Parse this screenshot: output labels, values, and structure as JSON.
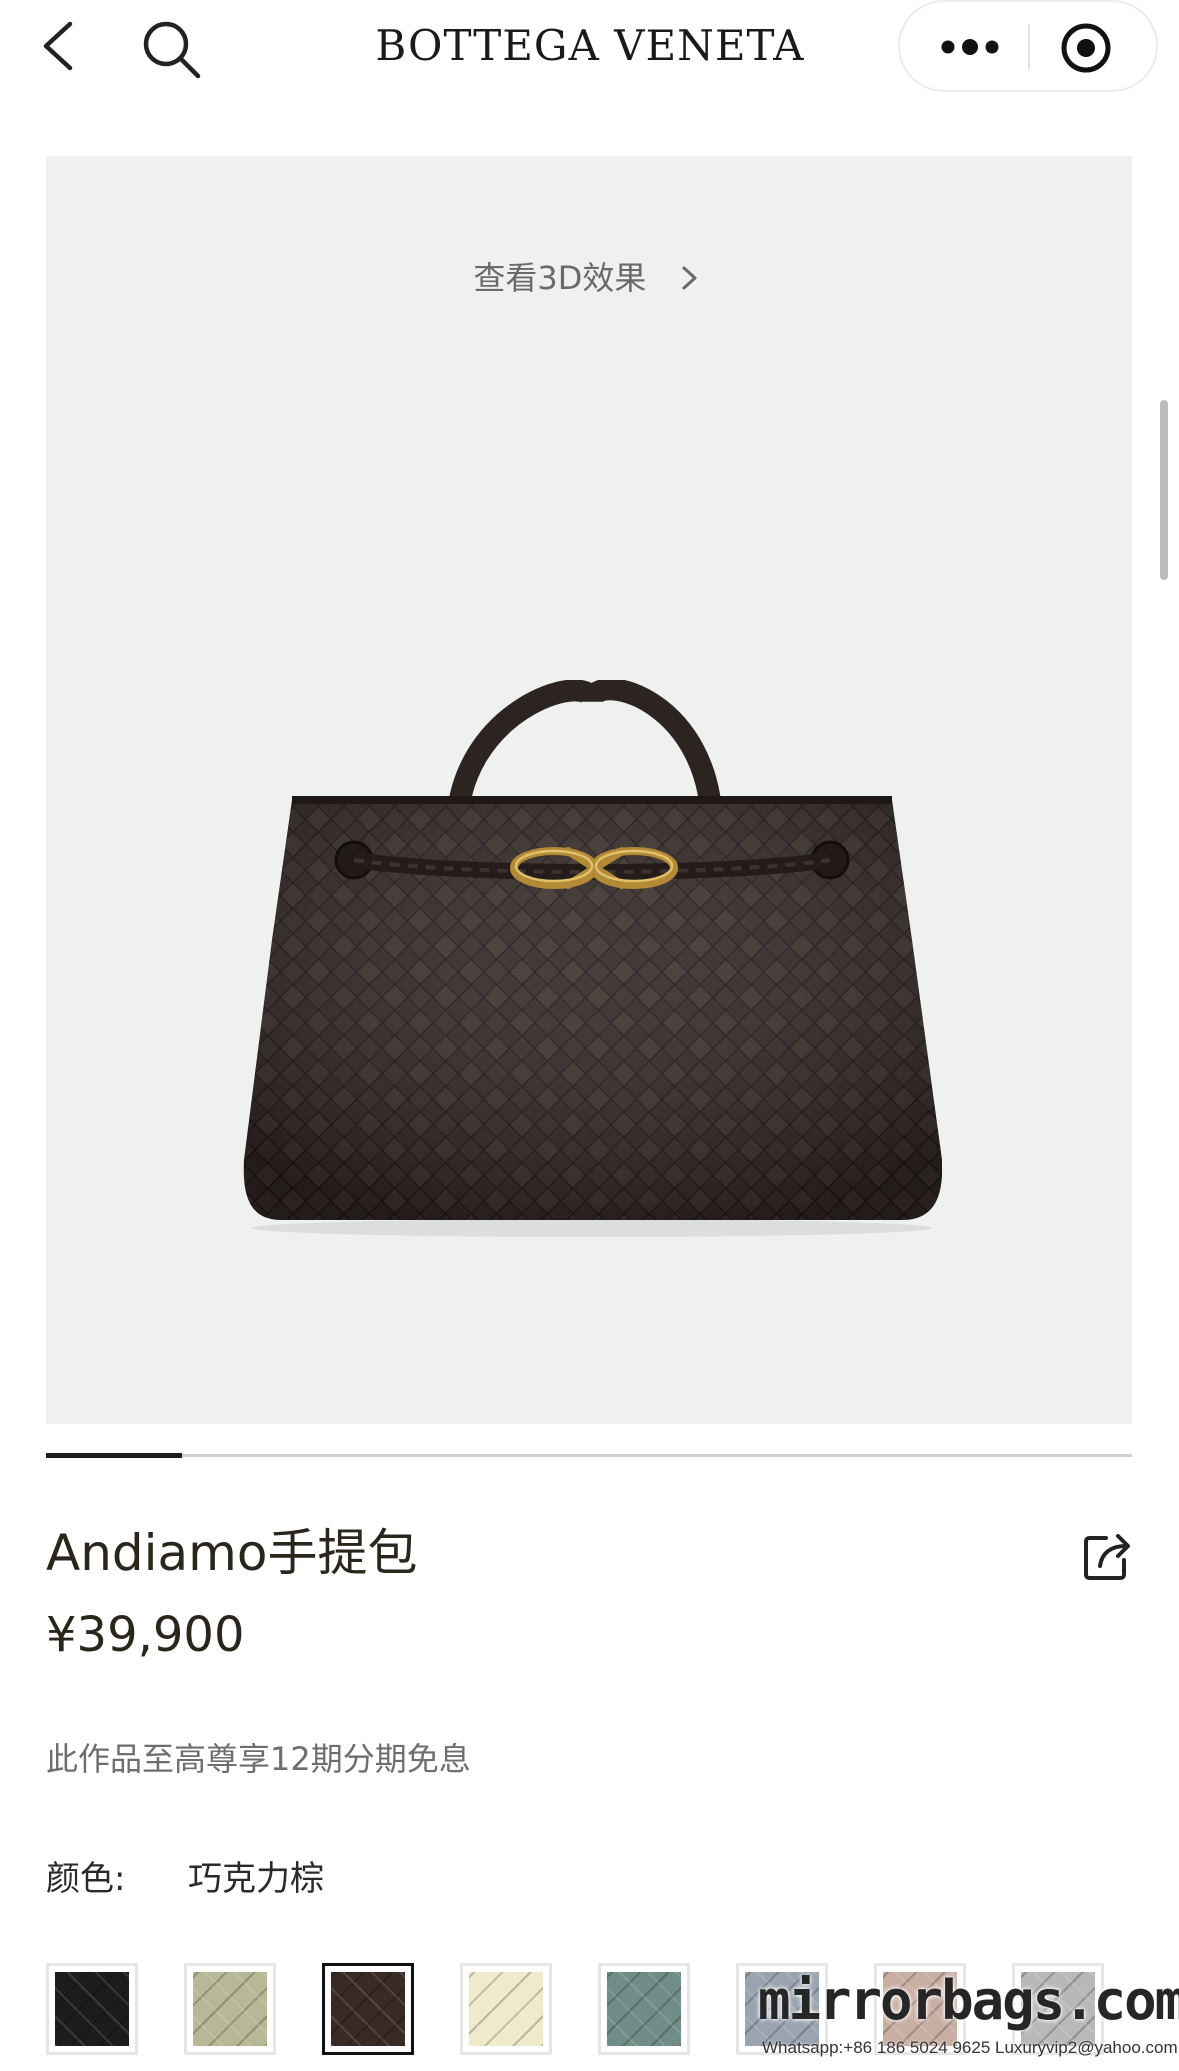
{
  "header": {
    "brand": "BOTTEGA VENETA",
    "back_icon": "chevron-left-icon",
    "search_icon": "search-icon",
    "more_icon": "more-dots-icon",
    "close_icon": "target-close-icon"
  },
  "gallery": {
    "view_3d_label": "查看3D效果",
    "image_description_icon": "woven-tote-bag",
    "background_color": "#eff1f1",
    "progress": 0.125
  },
  "product": {
    "title": "Andiamo手提包",
    "price": "¥39,900",
    "installment_note": "此作品至高尊享12期分期免息",
    "color_label": "颜色:",
    "color_value": "巧克力棕"
  },
  "swatches": [
    {
      "color": "#1c1c1c",
      "selected": false
    },
    {
      "color": "#b7b896",
      "selected": false
    },
    {
      "color": "#3a2a25",
      "selected": true
    },
    {
      "color": "#efeacb",
      "selected": false
    },
    {
      "color": "#6f8d86",
      "selected": false
    },
    {
      "color": "#9aa3b0",
      "selected": false
    },
    {
      "color": "#c9aea3",
      "selected": false
    },
    {
      "color": "#b8b8b6",
      "selected": false
    }
  ],
  "watermark": {
    "site": "mirrorbags.com",
    "contact": "Whatsapp:+86 186 5024 9625   Luxuryvip2@yahoo.com"
  }
}
